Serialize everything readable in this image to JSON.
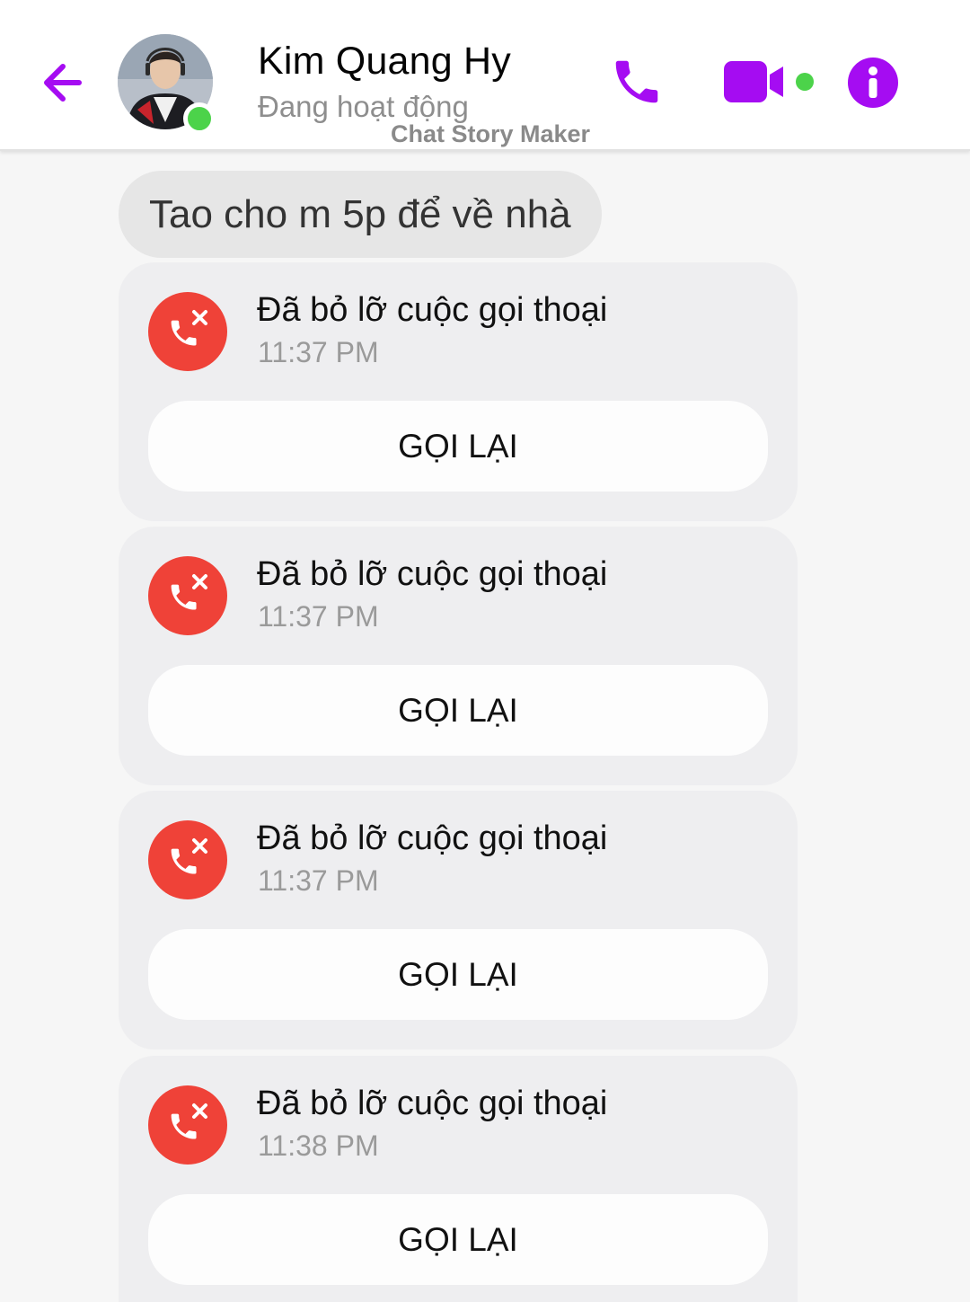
{
  "header": {
    "contact_name": "Kim Quang Hy",
    "status": "Đang hoạt động",
    "watermark": "Chat Story Maker",
    "icons": {
      "back": "arrow-left-icon",
      "call": "phone-icon",
      "video": "video-camera-icon",
      "info": "info-icon"
    }
  },
  "colors": {
    "accent": "#a50cf2",
    "online": "#4cd34a",
    "missed_call": "#ef4238",
    "card_bg": "#eeeef0"
  },
  "messages": [
    {
      "text": "Tao cho m 5p để về nhà"
    }
  ],
  "missed_calls": [
    {
      "title": "Đã bỏ lỡ cuộc gọi thoại",
      "time": "11:37 PM",
      "button": "GỌI LẠI"
    },
    {
      "title": "Đã bỏ lỡ cuộc gọi thoại",
      "time": "11:37 PM",
      "button": "GỌI LẠI"
    },
    {
      "title": "Đã bỏ lỡ cuộc gọi thoại",
      "time": "11:37 PM",
      "button": "GỌI LẠI"
    },
    {
      "title": "Đã bỏ lỡ cuộc gọi thoại",
      "time": "11:38 PM",
      "button": "GỌI LẠI"
    }
  ]
}
